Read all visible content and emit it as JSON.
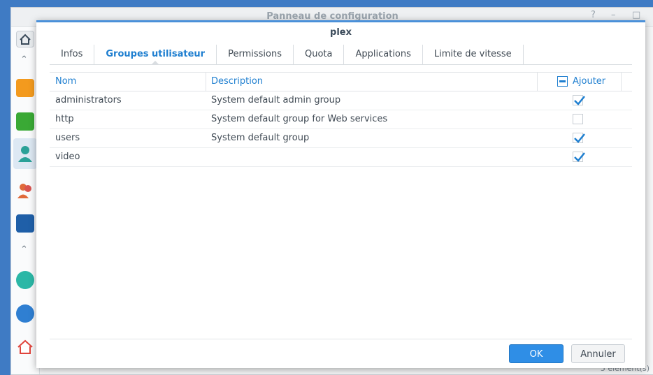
{
  "background_window": {
    "title": "Panneau de configuration",
    "help_label": "?",
    "minimize_label": "–",
    "maximize_label": "□",
    "footer_text": "5 élément(s)"
  },
  "dialog": {
    "title": "plex",
    "tabs": [
      {
        "label": "Infos",
        "active": false
      },
      {
        "label": "Groupes utilisateur",
        "active": true
      },
      {
        "label": "Permissions",
        "active": false
      },
      {
        "label": "Quota",
        "active": false
      },
      {
        "label": "Applications",
        "active": false
      },
      {
        "label": "Limite de vitesse",
        "active": false
      }
    ],
    "table": {
      "headers": {
        "name": "Nom",
        "description": "Description",
        "add": "Ajouter"
      },
      "rows": [
        {
          "name": "administrators",
          "description": "System default admin group",
          "checked": true
        },
        {
          "name": "http",
          "description": "System default group for Web services",
          "checked": false
        },
        {
          "name": "users",
          "description": "System default group",
          "checked": true
        },
        {
          "name": "video",
          "description": "",
          "checked": true
        }
      ]
    },
    "buttons": {
      "ok": "OK",
      "cancel": "Annuler"
    }
  },
  "colors": {
    "accent": "#1f7fd0",
    "ok_button": "#2f8ee6"
  }
}
